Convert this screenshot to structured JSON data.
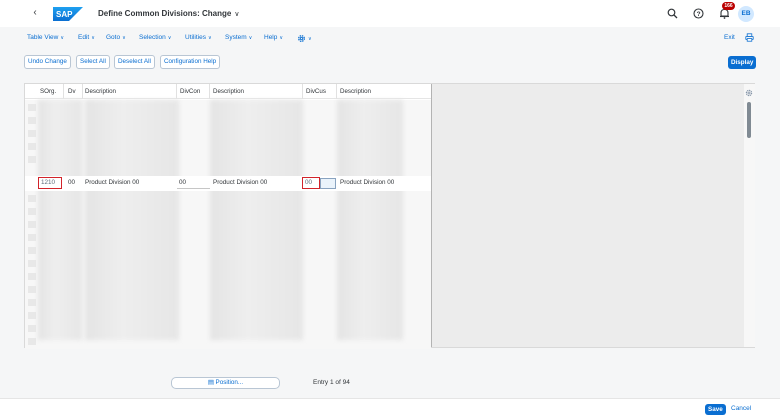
{
  "header": {
    "title": "Define Common Divisions: Change",
    "logo_text": "SAP",
    "notification_count": "166",
    "avatar_initials": "EB",
    "icons": [
      "back-icon",
      "search-icon",
      "help-icon",
      "bell-icon"
    ]
  },
  "menu": {
    "items": [
      "Table View",
      "Edit",
      "Goto",
      "Selection",
      "Utilities",
      "System",
      "Help"
    ],
    "exit_label": "Exit"
  },
  "toolbar": {
    "buttons": [
      "Undo Change",
      "Select All",
      "Deselect All",
      "Configuration Help"
    ],
    "display_label": "Display"
  },
  "table": {
    "columns": [
      "SOrg.",
      "Dv",
      "Description",
      "DivCon",
      "Description",
      "DivCus",
      "Description"
    ],
    "focus_row": {
      "sorg": "1210",
      "dv": "00",
      "description": "Product Division 00",
      "divcon": "00",
      "description2": "Product Division 00",
      "divcus": "00",
      "description3": "Product Division 00"
    }
  },
  "footer": {
    "position_label": "Position...",
    "entry_text": "Entry 1 of 94",
    "save_label": "Save",
    "cancel_label": "Cancel"
  },
  "colors": {
    "accent": "#0a6ed1",
    "highlight_border": "#d2232a",
    "badge": "#bb0000"
  }
}
